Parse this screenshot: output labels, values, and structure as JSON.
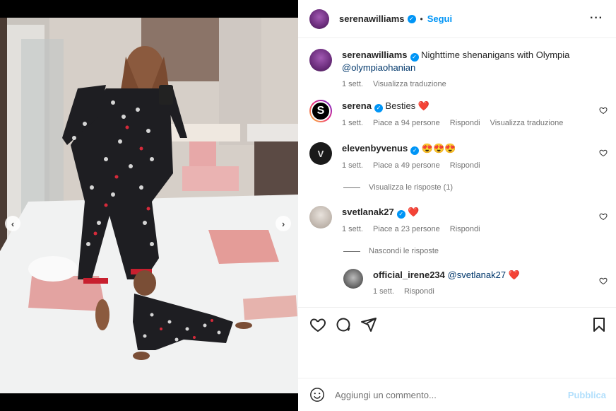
{
  "post": {
    "author": "serenawilliams",
    "separator": "•",
    "follow_label": "Segui",
    "more_label": "···",
    "caption_author": "serenawilliams",
    "caption_text": "Nighttime shenanigans with Olympia",
    "caption_mention": "@olympiaohanian",
    "caption_time": "1 sett.",
    "caption_translate": "Visualizza traduzione"
  },
  "media": {
    "prev_label": "‹",
    "next_label": "›",
    "slide_count": 2,
    "active_slide": 1
  },
  "comments": [
    {
      "user": "serena",
      "verified": true,
      "avatar_letter": "S",
      "text": "Besties",
      "emoji": "❤️",
      "time": "1 sett.",
      "likes": "Piace a 94 persone",
      "reply": "Rispondi",
      "translate": "Visualizza traduzione"
    },
    {
      "user": "elevenbyvenus",
      "verified": true,
      "avatar_letter": "V",
      "text": "😍😍😍",
      "time": "1 sett.",
      "likes": "Piace a 49 persone",
      "reply": "Rispondi",
      "replies_toggle": "Visualizza le risposte (1)"
    },
    {
      "user": "svetlanak27",
      "verified": true,
      "text": "❤️",
      "time": "1 sett.",
      "likes": "Piace a 23 persone",
      "reply": "Rispondi",
      "replies_toggle": "Nascondi le risposte"
    }
  ],
  "reply": {
    "user": "official_irene234",
    "mention": "@svetlanak27",
    "text": "❤️",
    "time": "1 sett.",
    "reply": "Rispondi"
  },
  "composer": {
    "placeholder": "Aggiungi un commento...",
    "publish_label": "Pubblica"
  },
  "icons": {
    "like": "heart-icon",
    "comment": "comment-icon",
    "share": "share-icon",
    "save": "bookmark-icon",
    "emoji": "emoji-icon",
    "verified": "verified-badge-icon"
  },
  "colors": {
    "link": "#0095f6",
    "mention": "#00376b",
    "muted": "#737373",
    "heart": "#ed4956",
    "publish_disabled": "#b2dffc"
  }
}
